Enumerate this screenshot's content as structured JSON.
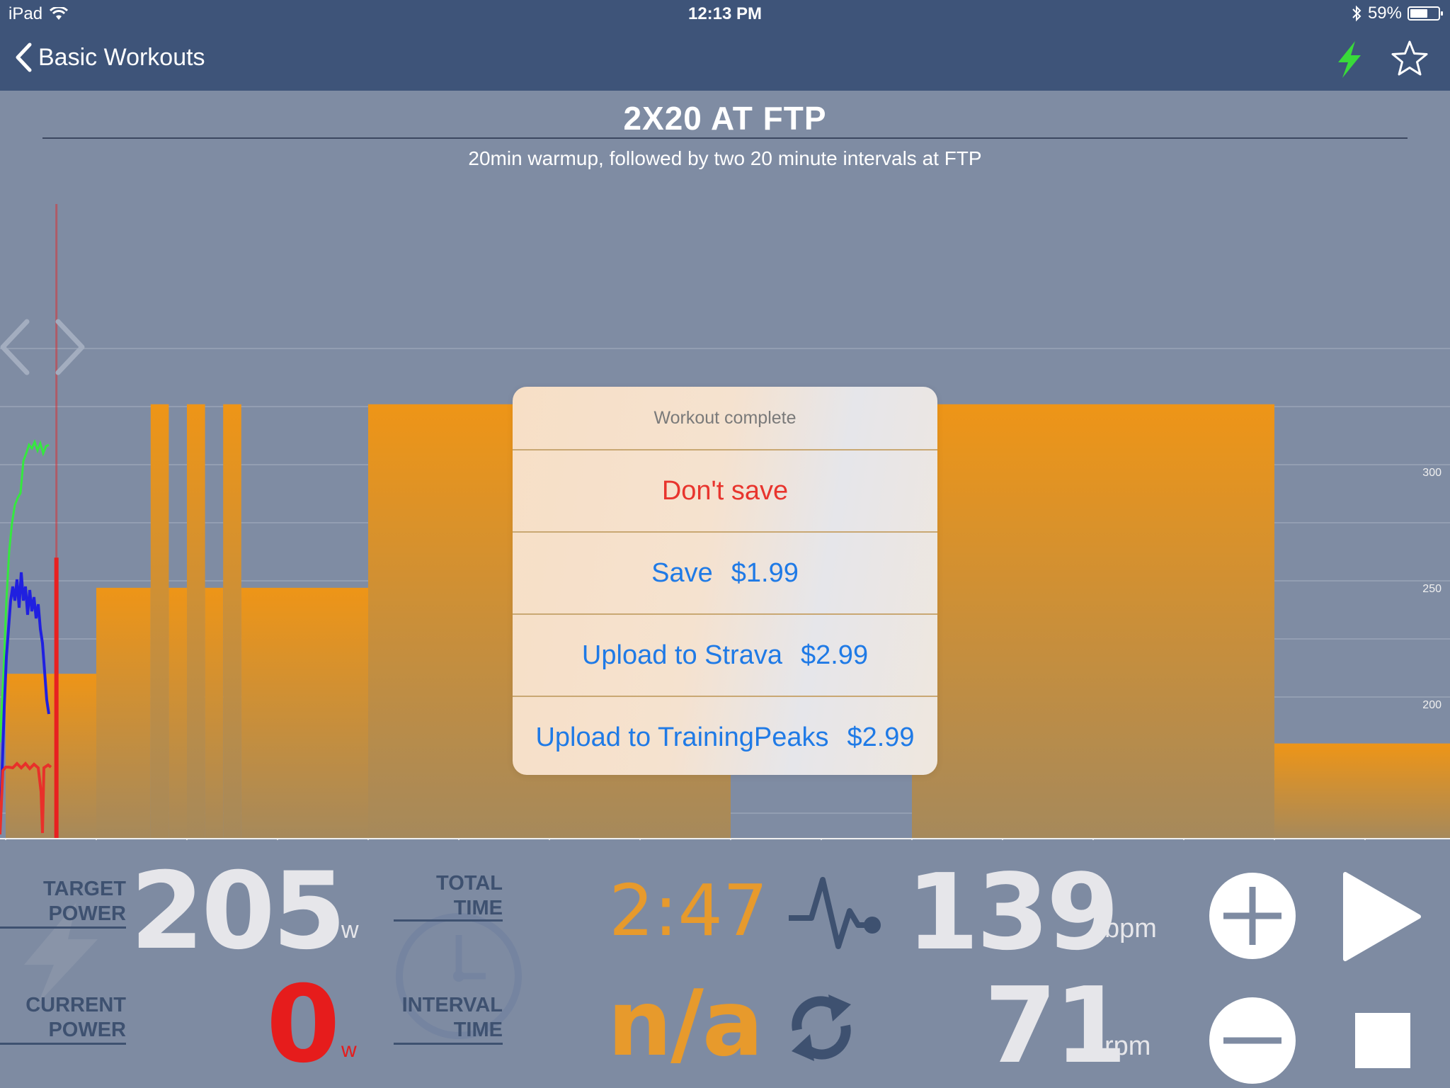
{
  "status_bar": {
    "device": "iPad",
    "time": "12:13 PM",
    "battery": "59%"
  },
  "nav": {
    "back_label": "Basic Workouts",
    "icons": [
      "lightning-bolt-icon",
      "star-icon"
    ],
    "bolt_color": "#39d93a"
  },
  "workout": {
    "title": "2X20 AT FTP",
    "subtitle": "20min warmup, followed by two 20 minute intervals at FTP"
  },
  "chart_data": {
    "type": "area",
    "x_ticks": [
      0,
      5,
      10,
      15,
      20,
      25,
      30,
      35,
      40,
      45,
      50,
      55,
      60,
      65,
      70,
      75
    ],
    "y_ticks": [
      200,
      250,
      300
    ],
    "xlim": [
      0,
      80
    ],
    "ylim": [
      178,
      338
    ],
    "target_segments": [
      {
        "start": 0,
        "end": 5,
        "power": 210
      },
      {
        "start": 5,
        "end": 8,
        "power": 247
      },
      {
        "start": 8,
        "end": 9,
        "power": 326
      },
      {
        "start": 9,
        "end": 10,
        "power": 247
      },
      {
        "start": 10,
        "end": 11,
        "power": 326
      },
      {
        "start": 11,
        "end": 12,
        "power": 247
      },
      {
        "start": 12,
        "end": 13,
        "power": 326
      },
      {
        "start": 13,
        "end": 20,
        "power": 247
      },
      {
        "start": 20,
        "end": 40,
        "power": 326
      },
      {
        "start": 50,
        "end": 70,
        "power": 326
      },
      {
        "start": 70,
        "end": 80,
        "power": 180
      }
    ],
    "current_position": 2.8,
    "colors": {
      "target_top": "#ee9517",
      "target_bottom": "#a6895b",
      "heart_rate": "#35e83f",
      "cadence": "#2020e0",
      "power": "#e8302a",
      "position_line": "#e82020"
    }
  },
  "modal": {
    "title": "Workout complete",
    "dont_save": "Don't save",
    "save_label": "Save",
    "save_price": "$1.99",
    "strava_label": "Upload to Strava",
    "strava_price": "$2.99",
    "tp_label": "Upload to TrainingPeaks",
    "tp_price": "$2.99"
  },
  "metrics": {
    "target_power_label_1": "TARGET",
    "target_power_label_2": "POWER",
    "target_power": "205",
    "target_power_unit": "w",
    "current_power_label_1": "CURRENT",
    "current_power_label_2": "POWER",
    "current_power": "0",
    "current_power_unit": "w",
    "total_time_label_1": "TOTAL",
    "total_time_label_2": "TIME",
    "total_time": "2:47",
    "interval_time_label_1": "INTERVAL",
    "interval_time_label_2": "TIME",
    "interval_time": "n/a",
    "heart_rate": "139",
    "heart_rate_unit": "bpm",
    "cadence": "71",
    "cadence_unit": "rpm"
  }
}
